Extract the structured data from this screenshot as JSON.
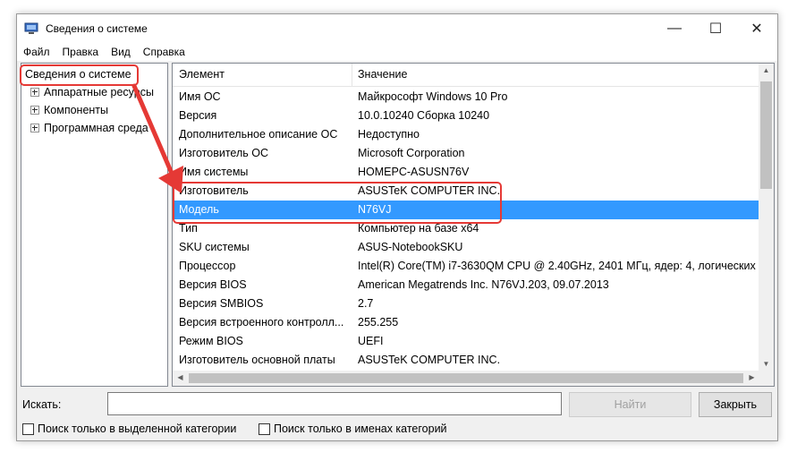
{
  "window": {
    "title": "Сведения о системе",
    "minimize_glyph": "—",
    "maximize_glyph": "☐",
    "close_glyph": "✕"
  },
  "menu": [
    "Файл",
    "Правка",
    "Вид",
    "Справка"
  ],
  "tree": {
    "root": "Сведения о системе",
    "children": [
      "Аппаратные ресурсы",
      "Компоненты",
      "Программная среда"
    ]
  },
  "list": {
    "headers": [
      "Элемент",
      "Значение"
    ],
    "rows": [
      {
        "key": "Имя ОС",
        "value": "Майкрософт Windows 10 Pro"
      },
      {
        "key": "Версия",
        "value": "10.0.10240 Сборка 10240"
      },
      {
        "key": "Дополнительное описание ОС",
        "value": "Недоступно"
      },
      {
        "key": "Изготовитель ОС",
        "value": "Microsoft Corporation"
      },
      {
        "key": "Имя системы",
        "value": "HOMEPC-ASUSN76V"
      },
      {
        "key": "Изготовитель",
        "value": "ASUSTeK COMPUTER INC."
      },
      {
        "key": "Модель",
        "value": "N76VJ"
      },
      {
        "key": "Тип",
        "value": "Компьютер на базе x64"
      },
      {
        "key": "SKU системы",
        "value": "ASUS-NotebookSKU"
      },
      {
        "key": "Процессор",
        "value": "Intel(R) Core(TM) i7-3630QM CPU @ 2.40GHz, 2401 МГц, ядер: 4, логических"
      },
      {
        "key": "Версия BIOS",
        "value": "American Megatrends Inc. N76VJ.203, 09.07.2013"
      },
      {
        "key": "Версия SMBIOS",
        "value": "2.7"
      },
      {
        "key": "Версия встроенного контролл...",
        "value": "255.255"
      },
      {
        "key": "Режим BIOS",
        "value": "UEFI"
      },
      {
        "key": "Изготовитель основной платы",
        "value": "ASUSTeK COMPUTER INC."
      }
    ],
    "selected_key": "Модель"
  },
  "search": {
    "label": "Искать:",
    "value": "",
    "find_button": "Найти",
    "close_button": "Закрыть",
    "option_selected_category": "Поиск только в выделенной категории",
    "option_category_names": "Поиск только в именах категорий"
  },
  "colors": {
    "selection": "#3399ff",
    "annotation": "#e53935"
  }
}
